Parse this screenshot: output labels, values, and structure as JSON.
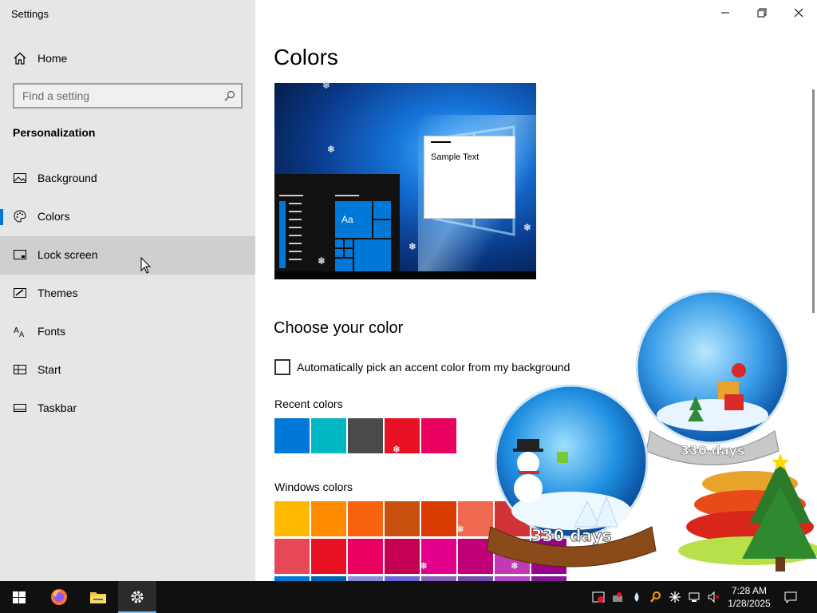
{
  "window": {
    "title": "Settings"
  },
  "sidebar": {
    "home_label": "Home",
    "search_placeholder": "Find a setting",
    "section_title": "Personalization",
    "items": [
      {
        "label": "Background",
        "icon": "image-icon"
      },
      {
        "label": "Colors",
        "icon": "palette-icon",
        "selected": true
      },
      {
        "label": "Lock screen",
        "icon": "lock-screen-icon",
        "hovered": true
      },
      {
        "label": "Themes",
        "icon": "brush-icon"
      },
      {
        "label": "Fonts",
        "icon": "font-icon"
      },
      {
        "label": "Start",
        "icon": "start-icon"
      },
      {
        "label": "Taskbar",
        "icon": "taskbar-icon"
      }
    ]
  },
  "main": {
    "page_title": "Colors",
    "preview": {
      "sample_text": "Sample Text",
      "tile_text": "Aa"
    },
    "choose_heading": "Choose your color",
    "auto_accent_label": "Automatically pick an accent color from my background",
    "auto_accent_checked": false,
    "recent_colors_label": "Recent colors",
    "recent_colors": [
      "#0078d7",
      "#00b7c3",
      "#4c4a48",
      "#e81123",
      "#ea005e"
    ],
    "windows_colors_label": "Windows colors",
    "windows_colors_row1": [
      "#ffb900",
      "#ff8c00",
      "#f7630c",
      "#ca5010",
      "#da3b01",
      "#ef6950",
      "#d13438",
      "#ff4343"
    ],
    "windows_colors_row2": [
      "#e74856",
      "#e81123",
      "#ea005e",
      "#c30052",
      "#e3008c",
      "#bf0077",
      "#c239b3",
      "#9a0089"
    ],
    "windows_colors_row3": [
      "#0078d7",
      "#0063b1",
      "#8e8cd8",
      "#6b69d6",
      "#8764b8",
      "#744da9",
      "#b146c2",
      "#881798"
    ]
  },
  "decoration": {
    "globe_label_1": "330 days",
    "globe_label_2": "330 days"
  },
  "taskbar": {
    "apps": [
      "windows-start-icon",
      "firefox-icon",
      "file-explorer-icon",
      "settings-icon"
    ],
    "time": "7:28 AM",
    "date": "1/28/2025"
  },
  "colors": {
    "accent": "#0078d7",
    "sidebar_bg": "#e6e6e6",
    "taskbar_bg": "#101010"
  }
}
